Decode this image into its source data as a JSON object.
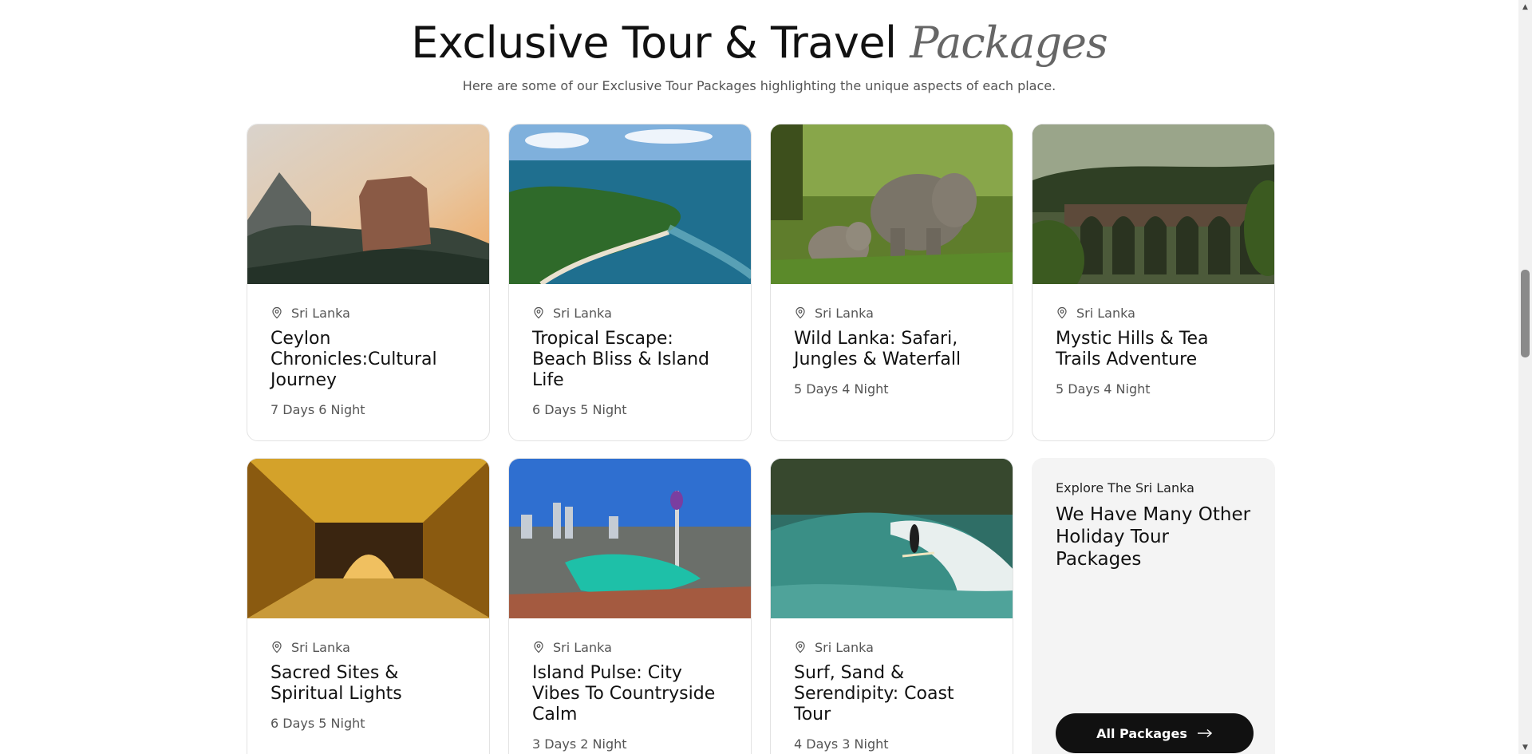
{
  "header": {
    "title_main": "Exclusive Tour & Travel",
    "title_italic": "Packages",
    "subtitle": "Here are some of our Exclusive Tour Packages highlighting the unique aspects of each place."
  },
  "packages": [
    {
      "location": "Sri Lanka",
      "title": "Ceylon Chronicles:Cultural Journey",
      "duration": "7 Days 6 Night",
      "image_icon": "rock-fortress-image"
    },
    {
      "location": "Sri Lanka",
      "title": "Tropical Escape: Beach Bliss & Island Life",
      "duration": "6 Days 5 Night",
      "image_icon": "island-coast-image"
    },
    {
      "location": "Sri Lanka",
      "title": "Wild Lanka: Safari, Jungles & Waterfall",
      "duration": "5 Days 4 Night",
      "image_icon": "elephants-image"
    },
    {
      "location": "Sri Lanka",
      "title": "Mystic Hills & Tea Trails Adventure",
      "duration": "5 Days 4 Night",
      "image_icon": "arch-bridge-image"
    },
    {
      "location": "Sri Lanka",
      "title": "Sacred Sites & Spiritual Lights",
      "duration": "6 Days 5 Night",
      "image_icon": "golden-temple-image"
    },
    {
      "location": "Sri Lanka",
      "title": "Island Pulse: City Vibes To Countryside Calm",
      "duration": "3 Days 2 Night",
      "image_icon": "city-skyline-image"
    },
    {
      "location": "Sri Lanka",
      "title": "Surf, Sand & Serendipity: Coast Tour",
      "duration": "4 Days 3 Night",
      "image_icon": "surfer-wave-image"
    }
  ],
  "cta": {
    "eyebrow": "Explore The Sri Lanka",
    "title": "We Have Many Other Holiday Tour Packages",
    "button_label": "All Packages",
    "button_icon": "arrow-right-icon"
  },
  "colors": {
    "accent": "#111111",
    "cta_bg": "#f4f4f4",
    "border": "#e3e3e3"
  }
}
